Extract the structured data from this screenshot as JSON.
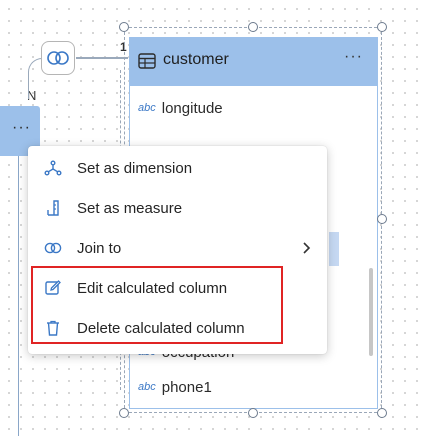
{
  "canvas": {
    "left_table": {
      "more_label": "···",
      "relation_many": "N"
    },
    "relation_one": "1"
  },
  "customer_table": {
    "title": "customer",
    "more_label": "···",
    "type_label": "abc",
    "fields": {
      "top": "longitude",
      "partial1": "occupation",
      "bottom": "phone1"
    }
  },
  "context_menu": {
    "items": [
      {
        "label": "Set as dimension",
        "icon": "dimension-icon"
      },
      {
        "label": "Set as measure",
        "icon": "measure-icon"
      },
      {
        "label": "Join to",
        "icon": "join-icon"
      },
      {
        "label": "Edit calculated column",
        "icon": "edit-icon"
      },
      {
        "label": "Delete calculated column",
        "icon": "trash-icon"
      }
    ]
  },
  "colors": {
    "header": "#9cc0ea",
    "accent": "#3b78c6",
    "highlight": "#e02424"
  }
}
